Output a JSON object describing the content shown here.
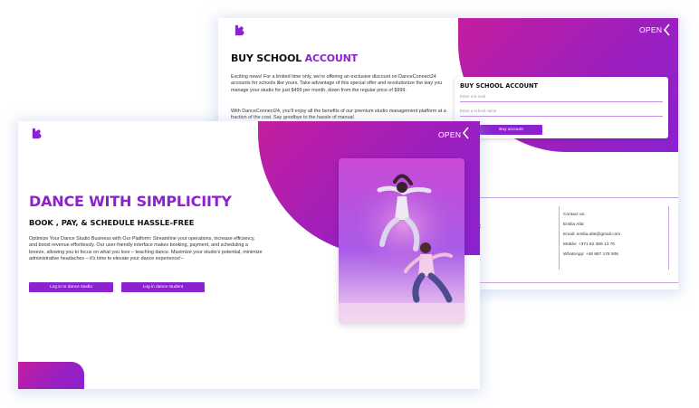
{
  "back_window": {
    "open_label": "OPEN",
    "title_plain": "BUY SCHOOL",
    "title_accent": "ACCOUNT",
    "paragraph1": "Exciting news! For a limited time only, we're offering an exclusive discount on DanceConnect24 accounts for schools like yours. Take advantage of this special offer and revolutionize the way you manage your studio for just $499 per month, down from the regular price of $999.",
    "paragraph2": "With DanceConnect24, you'll enjoy all the benefits of our premium studio management platform at a fraction of the cost. Say goodbye to the hassle of manual",
    "form": {
      "title": "BUY SCHOOL ACCOUNT",
      "email_placeholder": "Enter a E-mail",
      "school_placeholder": "Enter a school name",
      "button_label": "Buy account"
    },
    "footer_links": [
      "ok",
      "arn",
      "t"
    ],
    "contact": {
      "heading": "Contact us:",
      "name": "Emilia Afat",
      "email": "Email: emilia.afat@gmail.com",
      "mobile": "Mobile: +371 52 389 13 76",
      "whatsapp": "WhatsApp: +48 887 178 906"
    }
  },
  "front_window": {
    "open_label": "OPEN",
    "headline": "DANCE WITH SIMPLICIITY",
    "subheadline": "BOOK , PAY, & SCHEDULE HASSLE-FREE",
    "paragraph": "Optimize Your Dance Studio Business with Our Platform: Streamline your operations, increase efficiency, and boost revenue effortlessly. Our user-friendly interface makes booking, payment, and scheduling a breeze, allowing you to focus on what you love – teaching dance. Maximize your studio's potential, minimize administrative headaches – it's time to elevate your dance experience!--",
    "buttons": {
      "studio": "Log in to dance studio",
      "student": "Log in dance student"
    }
  },
  "colors": {
    "accent_purple": "#8a22cf",
    "gradient_magenta": "#c41e9e",
    "gradient_violet": "#8a22d0"
  },
  "icons": [
    "logo-icon",
    "chevron-left-icon",
    "dancers-photo"
  ]
}
